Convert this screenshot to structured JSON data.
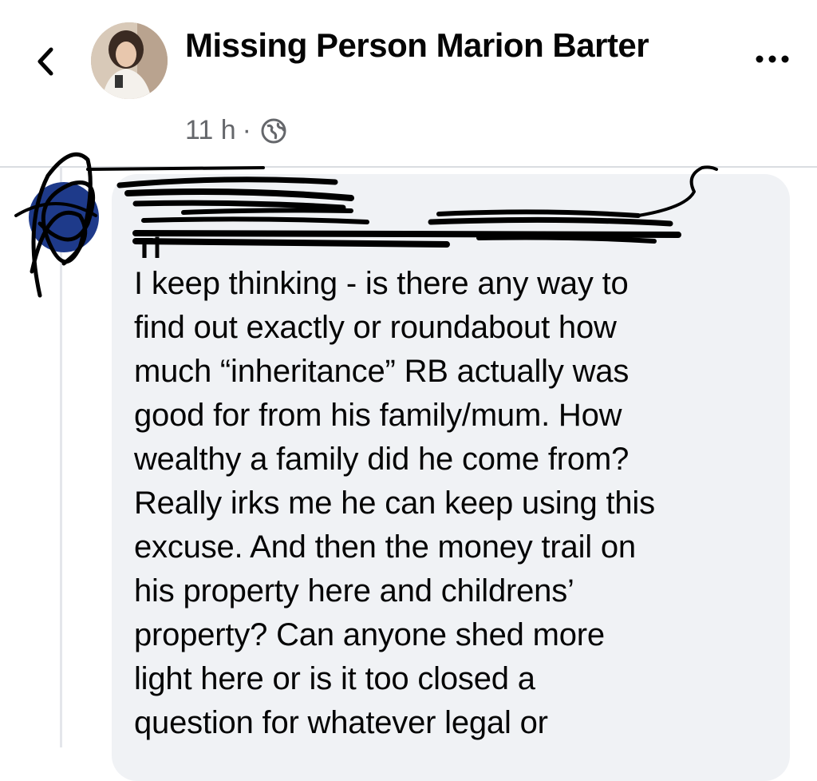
{
  "header": {
    "title": "Missing Person Marion Barter",
    "time": "11 h",
    "separator": "·",
    "privacy_icon": "globe-icon",
    "back_icon": "chevron-left-icon",
    "more_icon": "more-horizontal-icon"
  },
  "comment": {
    "author": "Tl",
    "text": "I keep thinking - is there any way to\nfind out exactly or roundabout how\nmuch “inheritance” RB actually was\ngood for from his family/mum. How\nwealthy a family did he come from?\nReally irks me he can keep using this\nexcuse. And then the money trail on\nhis property here and childrens’\nproperty? Can anyone shed more\nlight here or is it too closed a\nquestion for whatever legal or"
  },
  "colors": {
    "bubble": "#f0f2f5",
    "secondary_text": "#65676b",
    "primary_text": "#050505",
    "divider": "#dadde1"
  }
}
